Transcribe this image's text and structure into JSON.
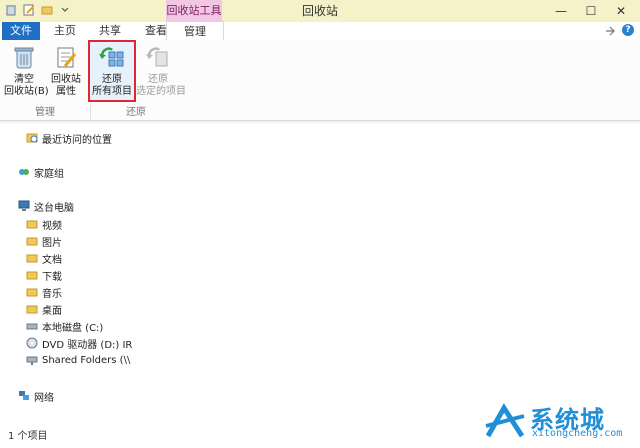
{
  "window": {
    "title": "回收站",
    "context_tab_group": "回收站工具",
    "min_symbol": "—",
    "max_symbol": "☐",
    "close_symbol": "✕"
  },
  "tabs": [
    {
      "label": "文件",
      "active": false
    },
    {
      "label": "主页",
      "active": false
    },
    {
      "label": "共享",
      "active": false
    },
    {
      "label": "查看",
      "active": false
    },
    {
      "label": "管理",
      "active": true
    }
  ],
  "help_symbol": "?",
  "ribbon": {
    "groups": [
      {
        "caption": "管理",
        "buttons": [
          {
            "label_line1": "清空",
            "label_line2": "回收站(B)",
            "icon": "empty-recycle-bin-icon"
          },
          {
            "label_line1": "回收站",
            "label_line2": "属性",
            "icon": "properties-icon"
          }
        ]
      },
      {
        "caption": "还原",
        "buttons": [
          {
            "label_line1": "还原",
            "label_line2": "所有项目",
            "icon": "restore-all-icon",
            "highlighted": true
          },
          {
            "label_line1": "还原",
            "label_line2": "选定的项目",
            "icon": "restore-selected-icon",
            "disabled": true
          }
        ]
      }
    ]
  },
  "nav": {
    "recent": "最近访问的位置",
    "homegroup": "家庭组",
    "this_pc": "这台电脑",
    "pc_items": [
      "视频",
      "图片",
      "文档",
      "下载",
      "音乐",
      "桌面",
      "本地磁盘 (C:)",
      "DVD 驱动器 (D:) IR",
      "Shared Folders (\\\\"
    ],
    "network": "网络"
  },
  "status": {
    "item_count": "1 个项目"
  },
  "watermark": {
    "text": "系统城",
    "url": "xitongcheng.com"
  },
  "colors": {
    "file_tab": "#1f6fc5",
    "context_tab": "#f3c6e4",
    "highlight": "#e0262e",
    "watermark": "#1f8fd8"
  }
}
